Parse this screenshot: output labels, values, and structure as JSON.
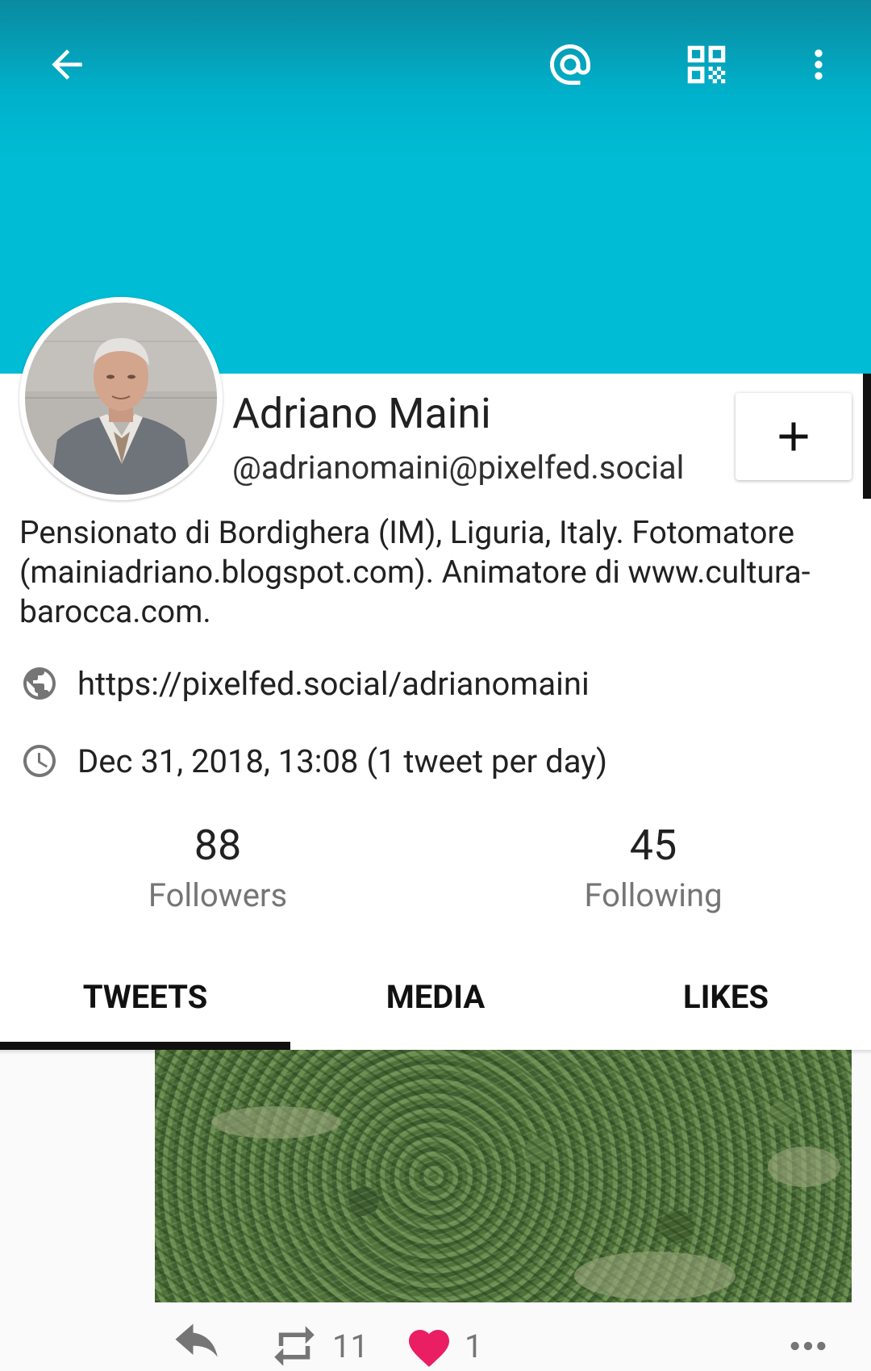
{
  "profile": {
    "name": "Adriano Maini",
    "handle": "@adrianomaini@pixelfed.social",
    "bio": "Pensionato di Bordighera (IM), Liguria, Italy. Fotomatore (mainiadriano.blogspot.com). Animatore di www.cultura-barocca.com.",
    "website": "https://pixelfed.social/adrianomaini",
    "joined": "Dec 31, 2018, 13:08 (1 tweet per day)"
  },
  "stats": {
    "followers_count": "88",
    "followers_label": "Followers",
    "following_count": "45",
    "following_label": "Following"
  },
  "tabs": [
    {
      "label": "TWEETS",
      "active": true
    },
    {
      "label": "MEDIA",
      "active": false
    },
    {
      "label": "LIKES",
      "active": false
    }
  ],
  "tweet": {
    "retweet_count": "11",
    "like_count": "1"
  },
  "colors": {
    "banner": "#00bcd4",
    "like": "#e91e63",
    "active_tab": "#111111"
  },
  "icons": [
    "back-arrow-icon",
    "mention-icon",
    "qr-code-icon",
    "overflow-menu-icon",
    "plus-icon",
    "globe-icon",
    "clock-icon",
    "reply-icon",
    "retweet-icon",
    "heart-icon",
    "more-dots-icon"
  ]
}
